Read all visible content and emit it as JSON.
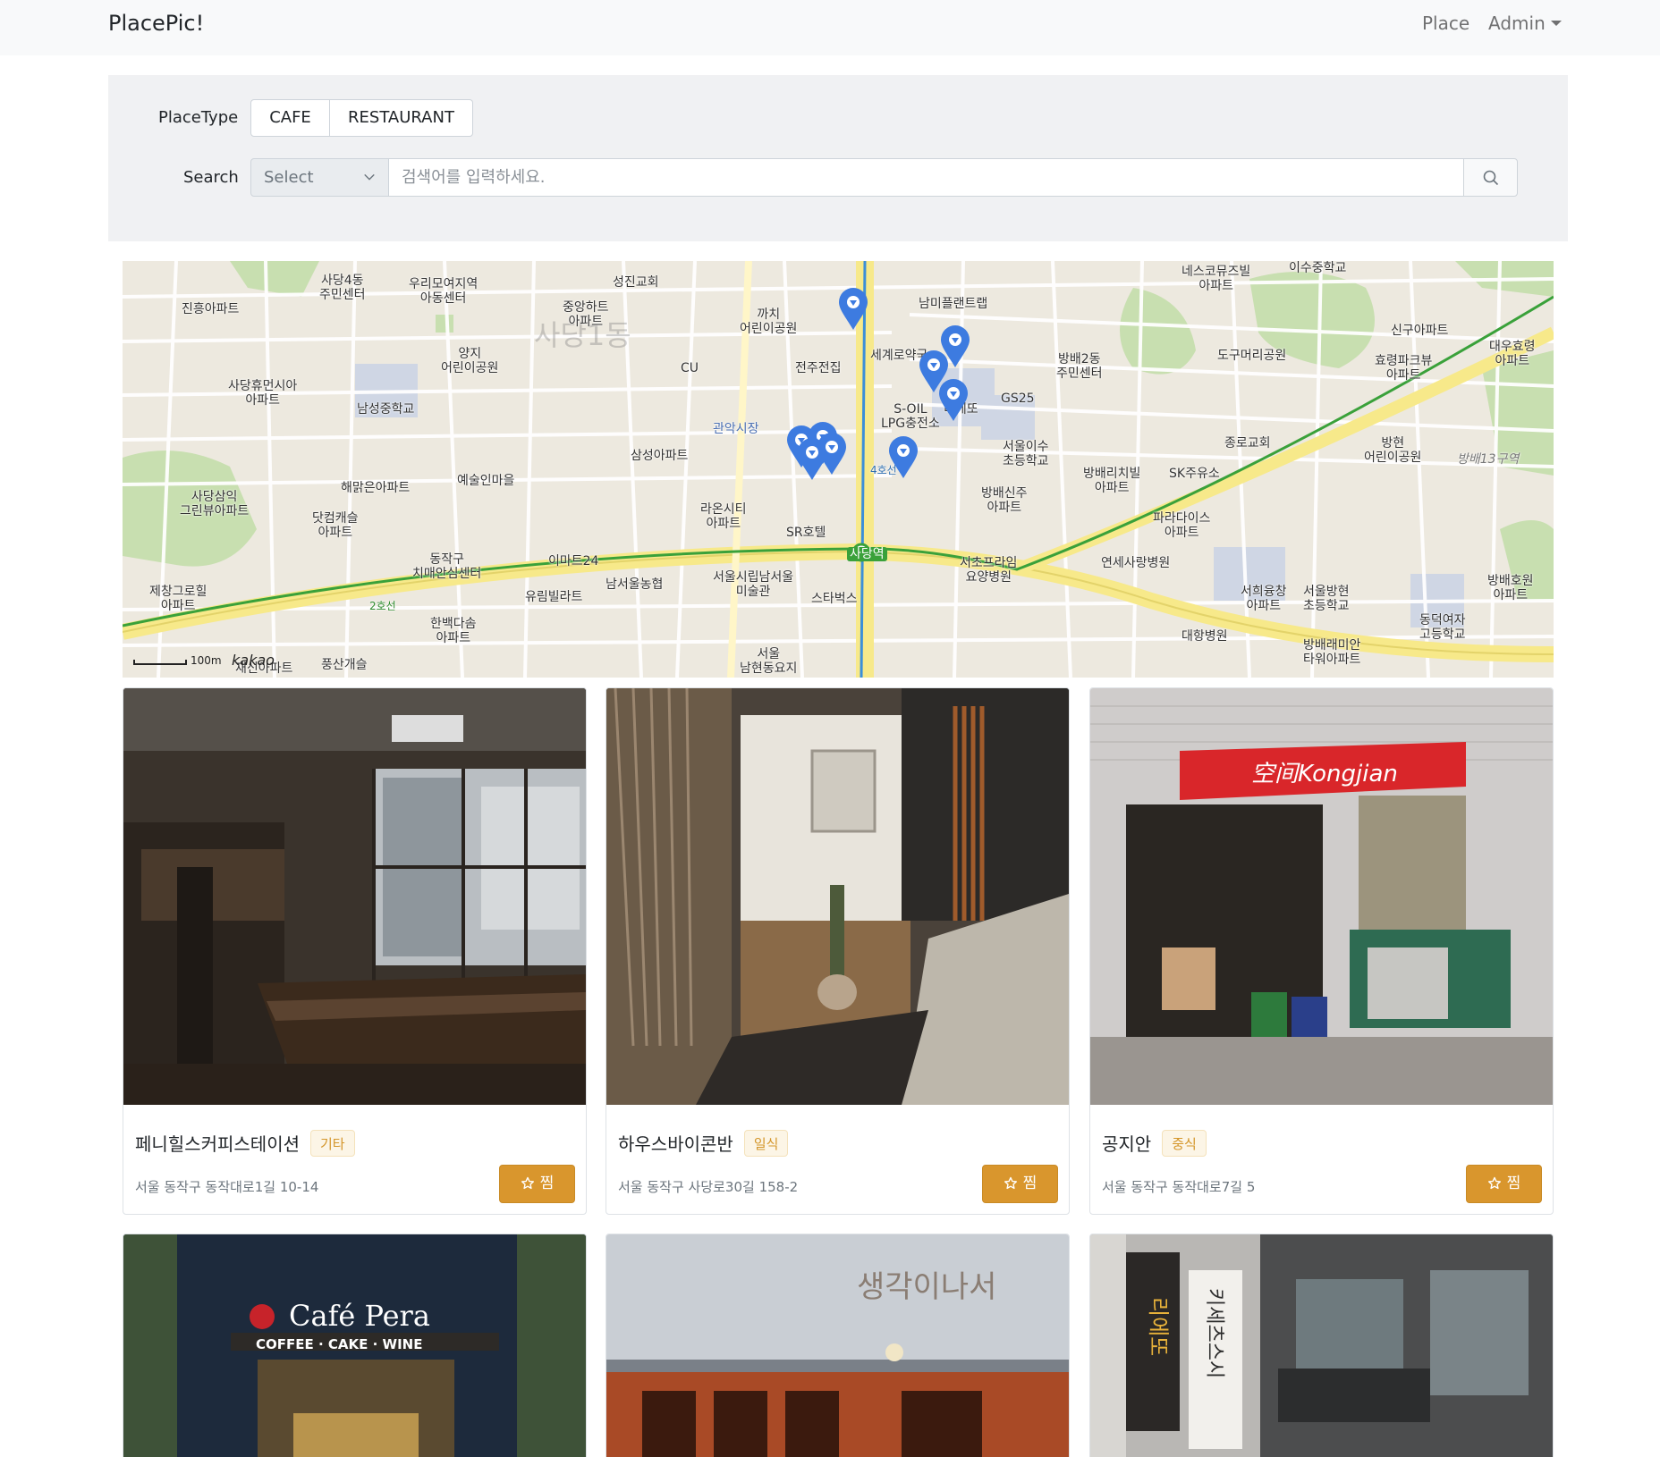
{
  "navbar": {
    "brand": "PlacePic!",
    "place_link": "Place",
    "admin_link": "Admin"
  },
  "filter": {
    "placetype_label": "PlaceType",
    "type_buttons": [
      "CAFE",
      "RESTAURANT"
    ],
    "search_label": "Search",
    "select_value": "Select",
    "search_placeholder": "검색어를 입력하세요."
  },
  "map": {
    "big_labels": [
      "사당1동"
    ],
    "labels": [
      "사당4동\n주민센터",
      "우리모여지역\n아동센터",
      "성진교회",
      "진흥아파트",
      "중앙하트\n아파트",
      "까치\n어린이공원",
      "남미플랜트랩",
      "세계로약국",
      "전주전집",
      "양지\n어린이공원",
      "CU",
      "사당휴먼시아\n아파트",
      "남성중학교",
      "관악시장",
      "삼성아파트",
      "S-OIL\nLPG충전소",
      "리에또",
      "GS25",
      "방배2동\n주민센터",
      "서울이수\n초등학교",
      "방배신주\n아파트",
      "네스코뮤즈빌\n아파트",
      "이수중학교",
      "도구머리공원",
      "신구아파트",
      "효령파크뷰\n아파트",
      "대우효령\n아파트",
      "종로교회",
      "방배리치빌\n아파트",
      "SK주유소",
      "방현\n어린이공원",
      "방배13구역",
      "해맑은아파트",
      "예술인마을",
      "사당삼익\n그린뷰아파트",
      "닷컴캐슬\n아파트",
      "라온시티\n아파트",
      "SR호텔",
      "사당역",
      "서초프라임\n요양병원",
      "파라다이스\n아파트",
      "연세사랑병원",
      "동작구\n치매안심센터",
      "이마트24",
      "남서울농협",
      "서울시립남서울\n미술관",
      "스타벅스",
      "제창그로힐\n아파트",
      "유림빌라트",
      "한백다솜\n아파트",
      "서울\n남현동요지",
      "서희융창\n아파트",
      "서울방현\n초등학교",
      "방배호원\n아파트",
      "동덕여자\n고등학교",
      "대항병원",
      "방배래미안\n타워아파트",
      "풍산개슬",
      "재신아파트",
      "2호선",
      "4호선"
    ],
    "scale": "100m",
    "attribution": "kakao",
    "marker_count": 9
  },
  "places": [
    {
      "name": "페니힐스커피스테이션",
      "category": "기타",
      "address": "서울 동작구 동작대로1길 10-14",
      "like_label": "찜"
    },
    {
      "name": "하우스바이콘반",
      "category": "일식",
      "address": "서울 동작구 사당로30길 158-2",
      "like_label": "찜"
    },
    {
      "name": "공지안",
      "category": "중식",
      "address": "서울 동작구 동작대로7길 5",
      "like_label": "찜"
    },
    {
      "name": "",
      "category": "",
      "address": "",
      "like_label": ""
    },
    {
      "name": "",
      "category": "",
      "address": "",
      "like_label": ""
    },
    {
      "name": "",
      "category": "",
      "address": "",
      "like_label": ""
    }
  ],
  "photo_signage": {
    "cafe_pera": "Café Pera",
    "cafe_pera_sub": "COFFEE · CAKE · WINE",
    "kongjian": "空间Kongjian",
    "saenggak": "생각이나서",
    "rieddo": "리에또",
    "kisechi": "키세츠스시"
  },
  "colors": {
    "accent": "#d9962d",
    "badge_text": "#d4962a",
    "marker": "#3d7be0",
    "line2": "#3aa13a",
    "line4": "#3b8fd9",
    "navbar_bg": "#f8f9fa",
    "panel_bg": "#f0f1f3"
  }
}
